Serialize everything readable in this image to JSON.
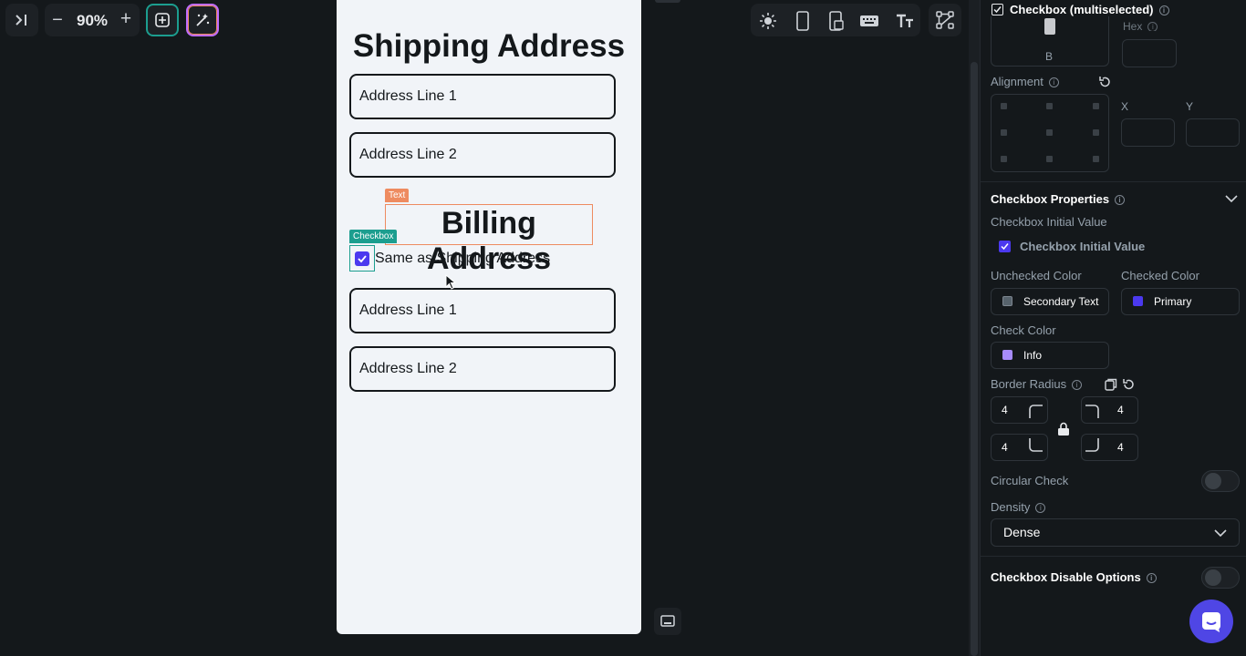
{
  "toolbar": {
    "zoom": "90%",
    "zoom_out": "−",
    "zoom_in": "+"
  },
  "canvas": {
    "shipping_title": "Shipping Address",
    "shipping_line1": "Address Line 1",
    "shipping_line2": "Address Line 2",
    "text_tag": "Text",
    "billing_title": "Billing Address",
    "checkbox_tag": "Checkbox",
    "checkbox_label": "Same as Shipping Address",
    "billing_line1": "Address Line 1",
    "billing_line2": "Address Line 2"
  },
  "panel": {
    "header_title": "Checkbox (multiselected)",
    "partial_label": "Hex",
    "partial_b": "B",
    "alignment_label": "Alignment",
    "x_label": "X",
    "y_label": "Y",
    "props_title": "Checkbox Properties",
    "initial_value_label": "Checkbox Initial Value",
    "initial_value_text": "Checkbox Initial Value",
    "unchecked_color_label": "Unchecked Color",
    "checked_color_label": "Checked Color",
    "unchecked_color_value": "Secondary Text",
    "checked_color_value": "Primary",
    "check_color_label": "Check Color",
    "check_color_value": "Info",
    "border_radius_label": "Border Radius",
    "radius_tl": "4",
    "radius_tr": "4",
    "radius_bl": "4",
    "radius_br": "4",
    "circular_check_label": "Circular Check",
    "density_label": "Density",
    "density_value": "Dense",
    "disable_options_label": "Checkbox Disable Options"
  },
  "colors": {
    "accent_teal": "#1c9e8f",
    "selection_orange": "#ee8b60",
    "primary": "#4b39ef",
    "info": "#a78bfa",
    "secondary_text": "#57636c",
    "chat_button": "#4f46e5"
  }
}
